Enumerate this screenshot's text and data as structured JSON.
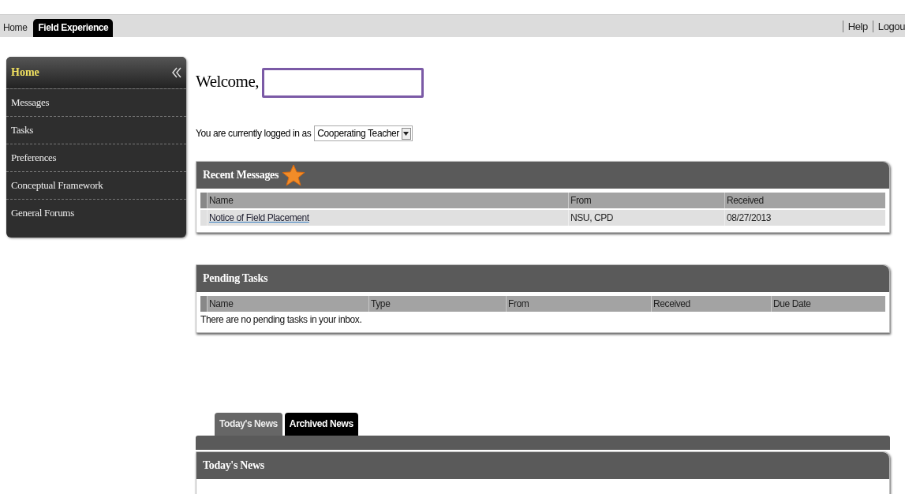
{
  "top_tabs": [
    {
      "label": "Home",
      "selected": true
    },
    {
      "label": "Field Experience",
      "selected": false
    }
  ],
  "top_links": [
    "Help",
    "Logou"
  ],
  "sidebar": {
    "title": "Home",
    "items": [
      "Messages",
      "Tasks",
      "Preferences",
      "Conceptual Framework",
      "General Forums"
    ]
  },
  "welcome": {
    "label": "Welcome,"
  },
  "login": {
    "label": "You are currently logged in as",
    "role": "Cooperating Teacher"
  },
  "recent_messages": {
    "title": "Recent Messages",
    "columns": [
      "Name",
      "From",
      "Received"
    ],
    "rows": [
      [
        "Notice of Field Placement",
        "NSU, CPD",
        "08/27/2013"
      ]
    ]
  },
  "pending_tasks": {
    "title": "Pending Tasks",
    "columns": [
      "Name",
      "Type",
      "From",
      "Received",
      "Due Date"
    ],
    "empty_text": "There are no pending tasks in your inbox."
  },
  "news_tabs": [
    {
      "label": "Today's News",
      "selected": true
    },
    {
      "label": "Archived News",
      "selected": false
    }
  ],
  "news": {
    "title": "Today's News"
  }
}
